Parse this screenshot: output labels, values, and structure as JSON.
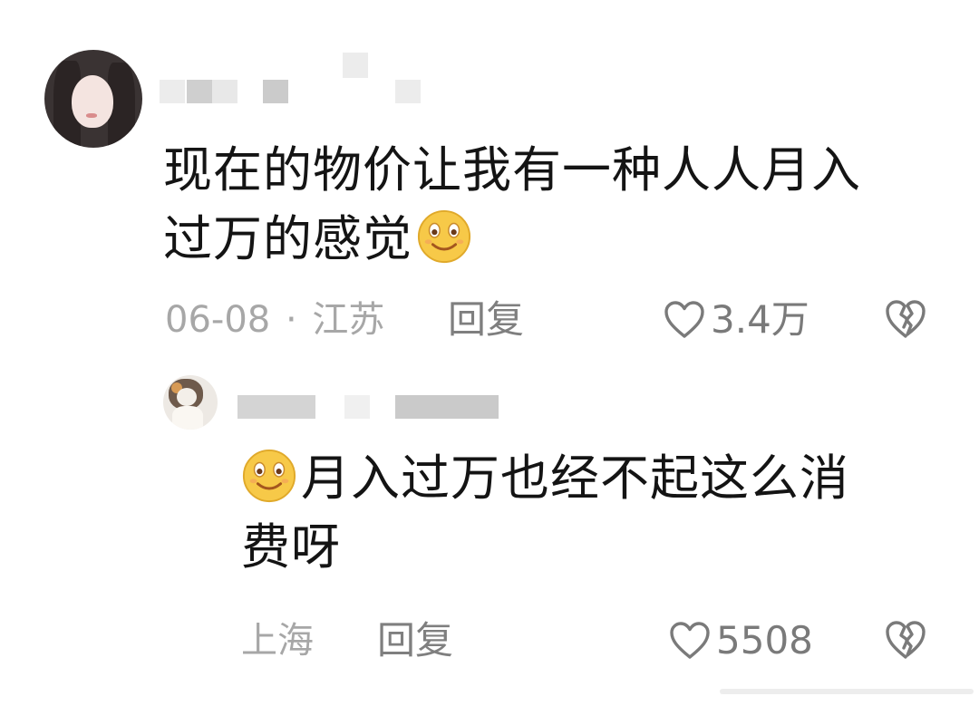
{
  "comment": {
    "text_line1": "现在的物价让我有一种人人月入",
    "text_line2": "过万的感觉",
    "emoji": "smiley-emoji",
    "date": "06-08",
    "separator": "·",
    "location": "江苏",
    "reply_label": "回复",
    "like_count": "3.4万"
  },
  "reply": {
    "text_line1": "月入过万也经不起这么消",
    "text_line2": "费呀",
    "emoji": "smiley-emoji",
    "location": "上海",
    "reply_label": "回复",
    "like_count": "5508"
  },
  "icons": {
    "like": "heart-outline-icon",
    "dislike": "broken-heart-icon"
  },
  "colors": {
    "text": "#141414",
    "meta": "#a7a7a7",
    "action": "#7a7a7a",
    "emoji_face": "#f7c948"
  }
}
